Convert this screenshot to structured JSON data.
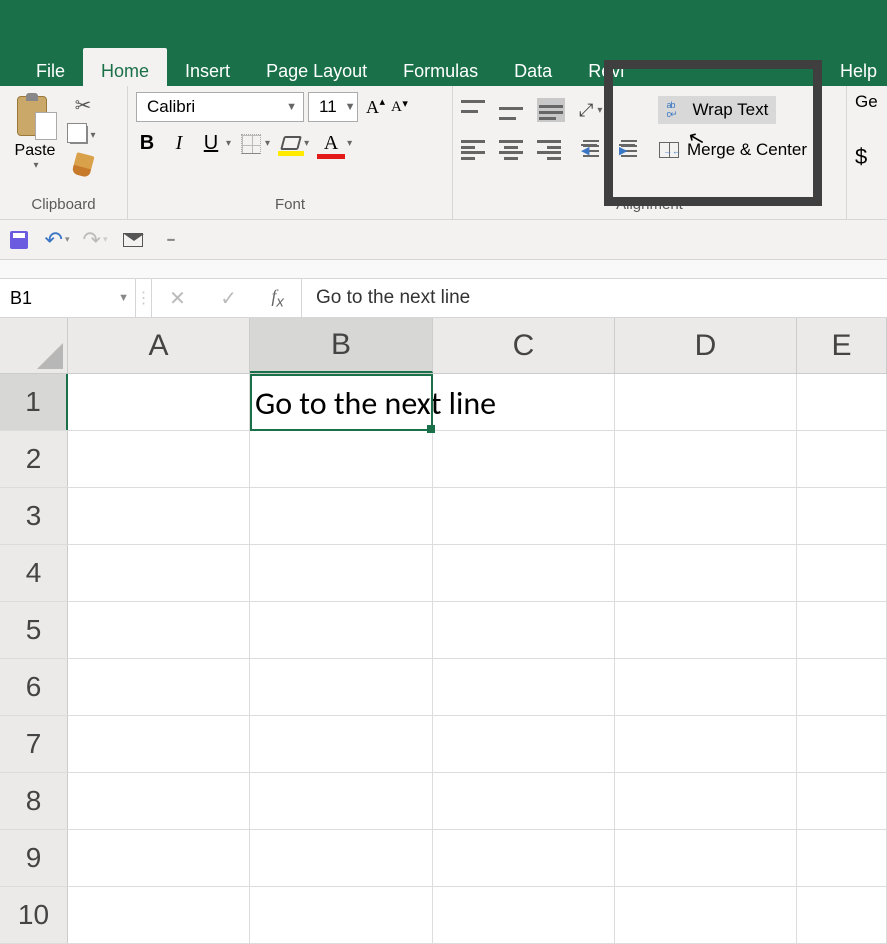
{
  "tabs": {
    "file": "File",
    "home": "Home",
    "insert": "Insert",
    "page_layout": "Page Layout",
    "formulas": "Formulas",
    "data": "Data",
    "review": "Revi",
    "help": "Help"
  },
  "ribbon": {
    "clipboard": {
      "paste": "Paste",
      "label": "Clipboard"
    },
    "font": {
      "name": "Calibri",
      "size": "11",
      "bold": "B",
      "italic": "I",
      "underline": "U",
      "label": "Font"
    },
    "alignment": {
      "wrap": "Wrap Text",
      "merge": "Merge & Center",
      "label": "Alignment"
    },
    "number": {
      "general_stub": "Ge",
      "currency": "$"
    }
  },
  "namebox": "B1",
  "formula_bar": "Go to the next line",
  "columns": [
    "A",
    "B",
    "C",
    "D",
    "E"
  ],
  "rows": [
    "1",
    "2",
    "3",
    "4",
    "5",
    "6",
    "7",
    "8",
    "9",
    "10"
  ],
  "active_cell": {
    "col": "B",
    "row": 1,
    "value": "Go to the next line"
  }
}
